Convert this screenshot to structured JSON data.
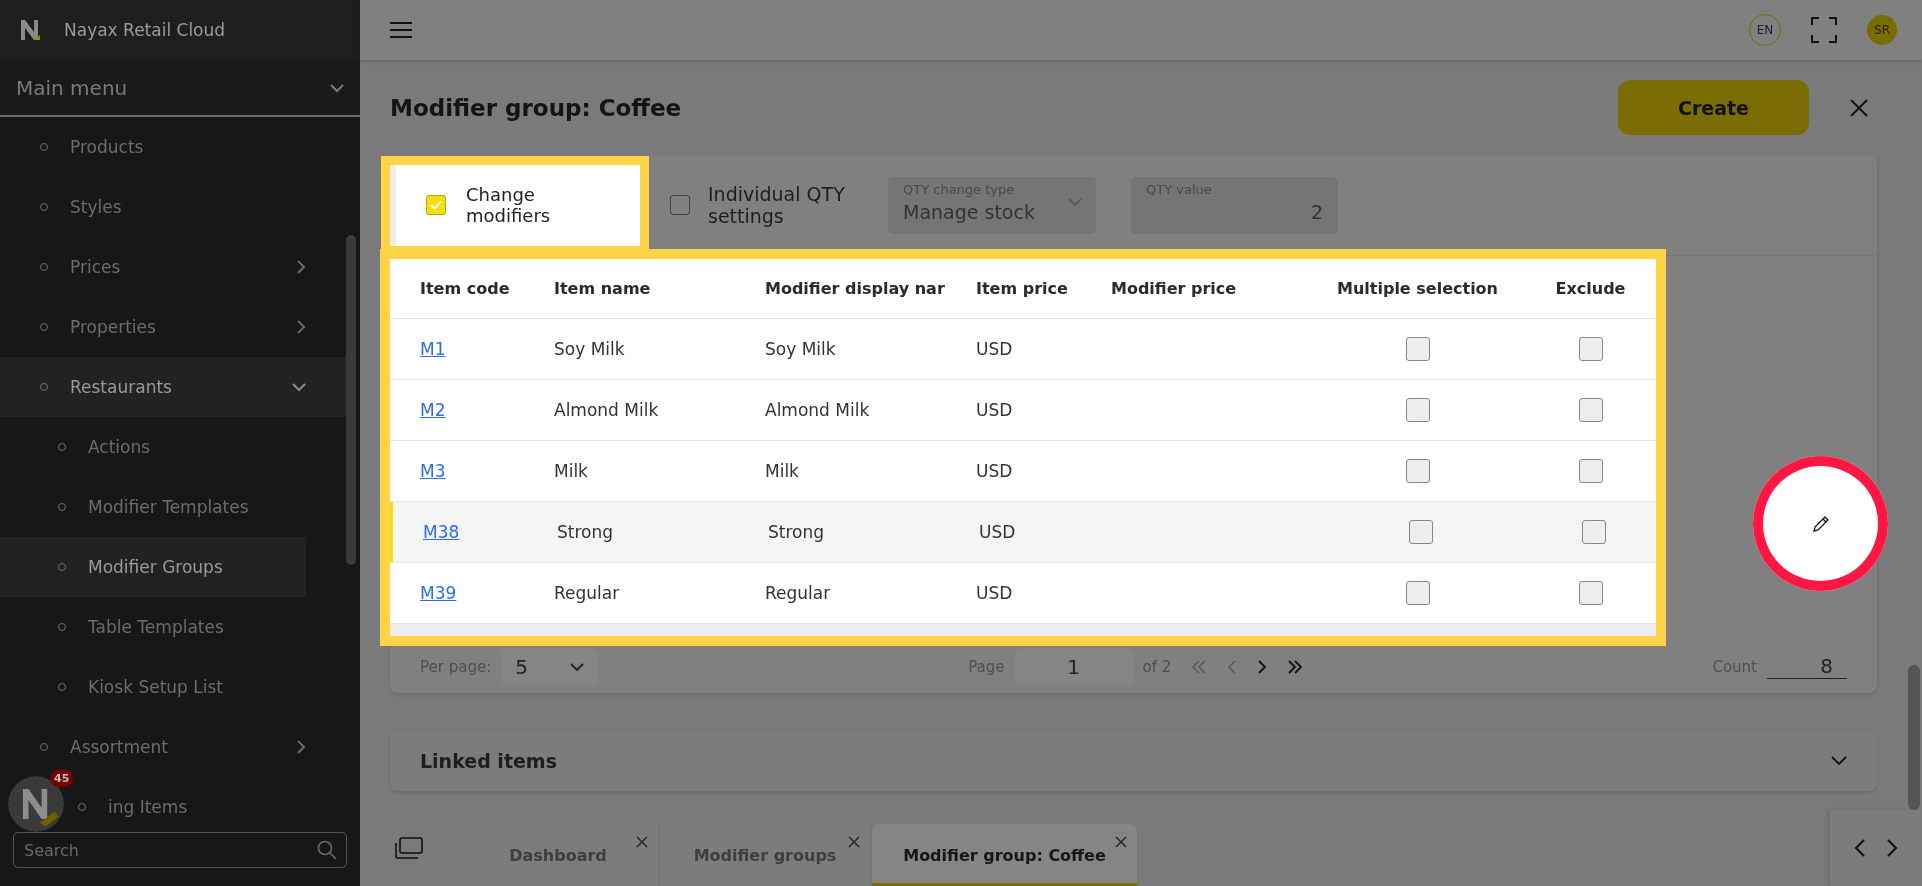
{
  "app": {
    "title": "Nayax Retail Cloud"
  },
  "sidebar": {
    "menu_title": "Main menu",
    "items": [
      {
        "label": "Products",
        "selected": false
      },
      {
        "label": "Styles",
        "selected": false
      },
      {
        "label": "Prices",
        "selected": false,
        "expanded": false
      },
      {
        "label": "Properties",
        "selected": false,
        "expanded": false
      },
      {
        "label": "Restaurants",
        "selected": false,
        "expanded": true,
        "children": [
          {
            "label": "Actions",
            "selected": false
          },
          {
            "label": "Modifier Templates",
            "selected": false
          },
          {
            "label": "Modifier Groups",
            "selected": true
          },
          {
            "label": "Table Templates",
            "selected": false
          },
          {
            "label": "Kiosk Setup List",
            "selected": false
          }
        ]
      },
      {
        "label": "Assortment",
        "selected": false,
        "expanded": false
      },
      {
        "label": "ing Items",
        "selected": false
      }
    ],
    "notification_count": "45",
    "search": {
      "placeholder": "Search"
    }
  },
  "header": {
    "language": "EN",
    "user_initials": "SR"
  },
  "page": {
    "title": "Modifier group: Coffee",
    "create_button": "Create"
  },
  "options": {
    "change_modifiers": {
      "label": "Change modifiers",
      "checked": true,
      "highlighted": true
    },
    "individual_qty": {
      "label": "Individual QTY settings",
      "checked": false
    },
    "qty_change_type": {
      "label": "QTY change type",
      "value": "Manage stock"
    },
    "qty_value": {
      "label": "QTY value",
      "value": "2"
    }
  },
  "table": {
    "highlighted": true,
    "columns": [
      "Item code",
      "Item name",
      "Modifier display nar",
      "Item price",
      "Modifier price",
      "Multiple selection",
      "Exclude"
    ],
    "rows": [
      {
        "item_code": "M1",
        "item_name": "Soy Milk",
        "modifier_display_name": "Soy Milk",
        "item_price": "USD",
        "multiple_selection": false,
        "exclude": false,
        "selected": false
      },
      {
        "item_code": "M2",
        "item_name": "Almond Milk",
        "modifier_display_name": "Almond Milk",
        "item_price": "USD",
        "multiple_selection": false,
        "exclude": false,
        "selected": false
      },
      {
        "item_code": "M3",
        "item_name": "Milk",
        "modifier_display_name": "Milk",
        "item_price": "USD",
        "multiple_selection": false,
        "exclude": false,
        "selected": false
      },
      {
        "item_code": "M38",
        "item_name": "Strong",
        "modifier_display_name": "Strong",
        "item_price": "USD",
        "multiple_selection": false,
        "exclude": false,
        "selected": true
      },
      {
        "item_code": "M39",
        "item_name": "Regular",
        "modifier_display_name": "Regular",
        "item_price": "USD",
        "multiple_selection": false,
        "exclude": false,
        "selected": false
      }
    ]
  },
  "pagination": {
    "per_page_label": "Per page:",
    "per_page": "5",
    "page_label": "Page",
    "page": "1",
    "of_pages": "of 2",
    "count_label": "Count",
    "count": "8"
  },
  "edit_button": {
    "highlighted": true
  },
  "linked_items": {
    "title": "Linked items",
    "expanded": false
  },
  "tabs": [
    {
      "label": "Dashboard",
      "selected": false
    },
    {
      "label": "Modifier groups",
      "selected": false
    },
    {
      "label": "Modifier group: Coffee",
      "selected": true
    }
  ]
}
